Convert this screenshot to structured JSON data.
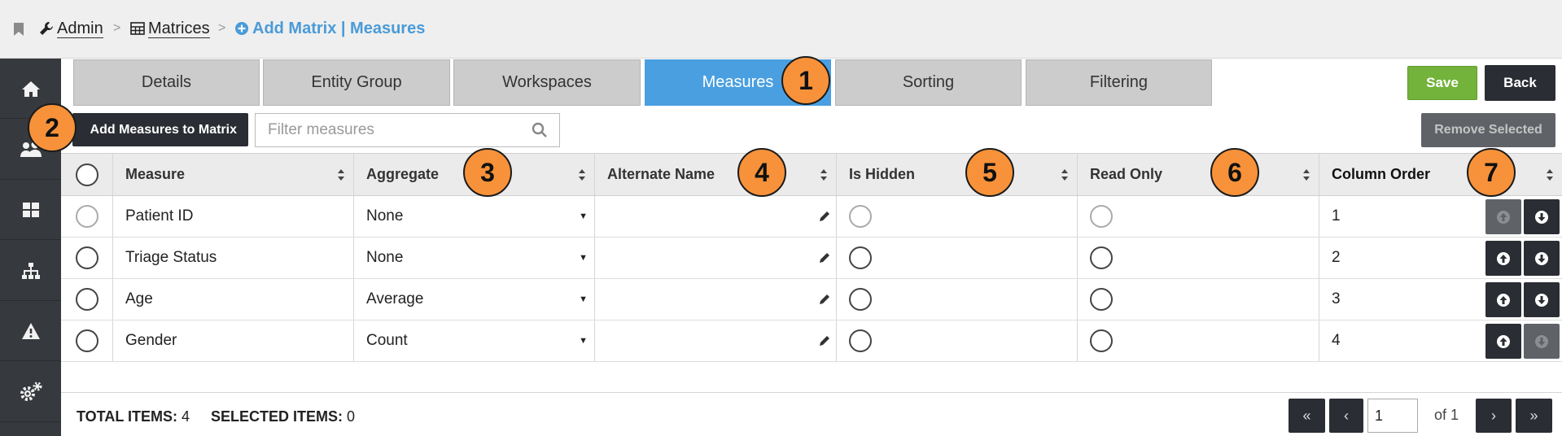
{
  "breadcrumb": {
    "admin": "Admin",
    "matrices": "Matrices",
    "current": "Add Matrix | Measures"
  },
  "sidebar": {
    "items": [
      {
        "icon": "home-icon"
      },
      {
        "icon": "users-icon"
      },
      {
        "icon": "dashboard-icon"
      },
      {
        "icon": "hierarchy-icon"
      },
      {
        "icon": "warning-icon"
      },
      {
        "icon": "gears-icon"
      }
    ]
  },
  "tabs": [
    {
      "label": "Details"
    },
    {
      "label": "Entity Group"
    },
    {
      "label": "Workspaces"
    },
    {
      "label": "Measures",
      "active": true
    },
    {
      "label": "Sorting"
    },
    {
      "label": "Filtering"
    }
  ],
  "actions": {
    "save": "Save",
    "back": "Back",
    "add_measures": "Add Measures to Matrix",
    "remove_selected": "Remove Selected"
  },
  "filter": {
    "placeholder": "Filter measures"
  },
  "table": {
    "headers": [
      "Measure",
      "Aggregate",
      "Alternate Name",
      "Is Hidden",
      "Read Only",
      "Column Order"
    ],
    "rows": [
      {
        "measure": "Patient ID",
        "aggregate": "None",
        "alternate_name": "",
        "order": "1"
      },
      {
        "measure": "Triage Status",
        "aggregate": "None",
        "alternate_name": "",
        "order": "2"
      },
      {
        "measure": "Age",
        "aggregate": "Average",
        "alternate_name": "",
        "order": "3"
      },
      {
        "measure": "Gender",
        "aggregate": "Count",
        "alternate_name": "",
        "order": "4"
      }
    ]
  },
  "footer": {
    "total_label": "TOTAL ITEMS:",
    "total_value": "4",
    "selected_label": "SELECTED ITEMS:",
    "selected_value": "0",
    "page_value": "1",
    "page_of": "of 1"
  },
  "callouts": [
    "1",
    "2",
    "3",
    "4",
    "5",
    "6",
    "7"
  ],
  "colors": {
    "accent": "#4a9fe0",
    "save": "#73b33b",
    "dark_button": "#2a2d33",
    "callout": "#f7923a",
    "sidebar": "#36393d"
  }
}
